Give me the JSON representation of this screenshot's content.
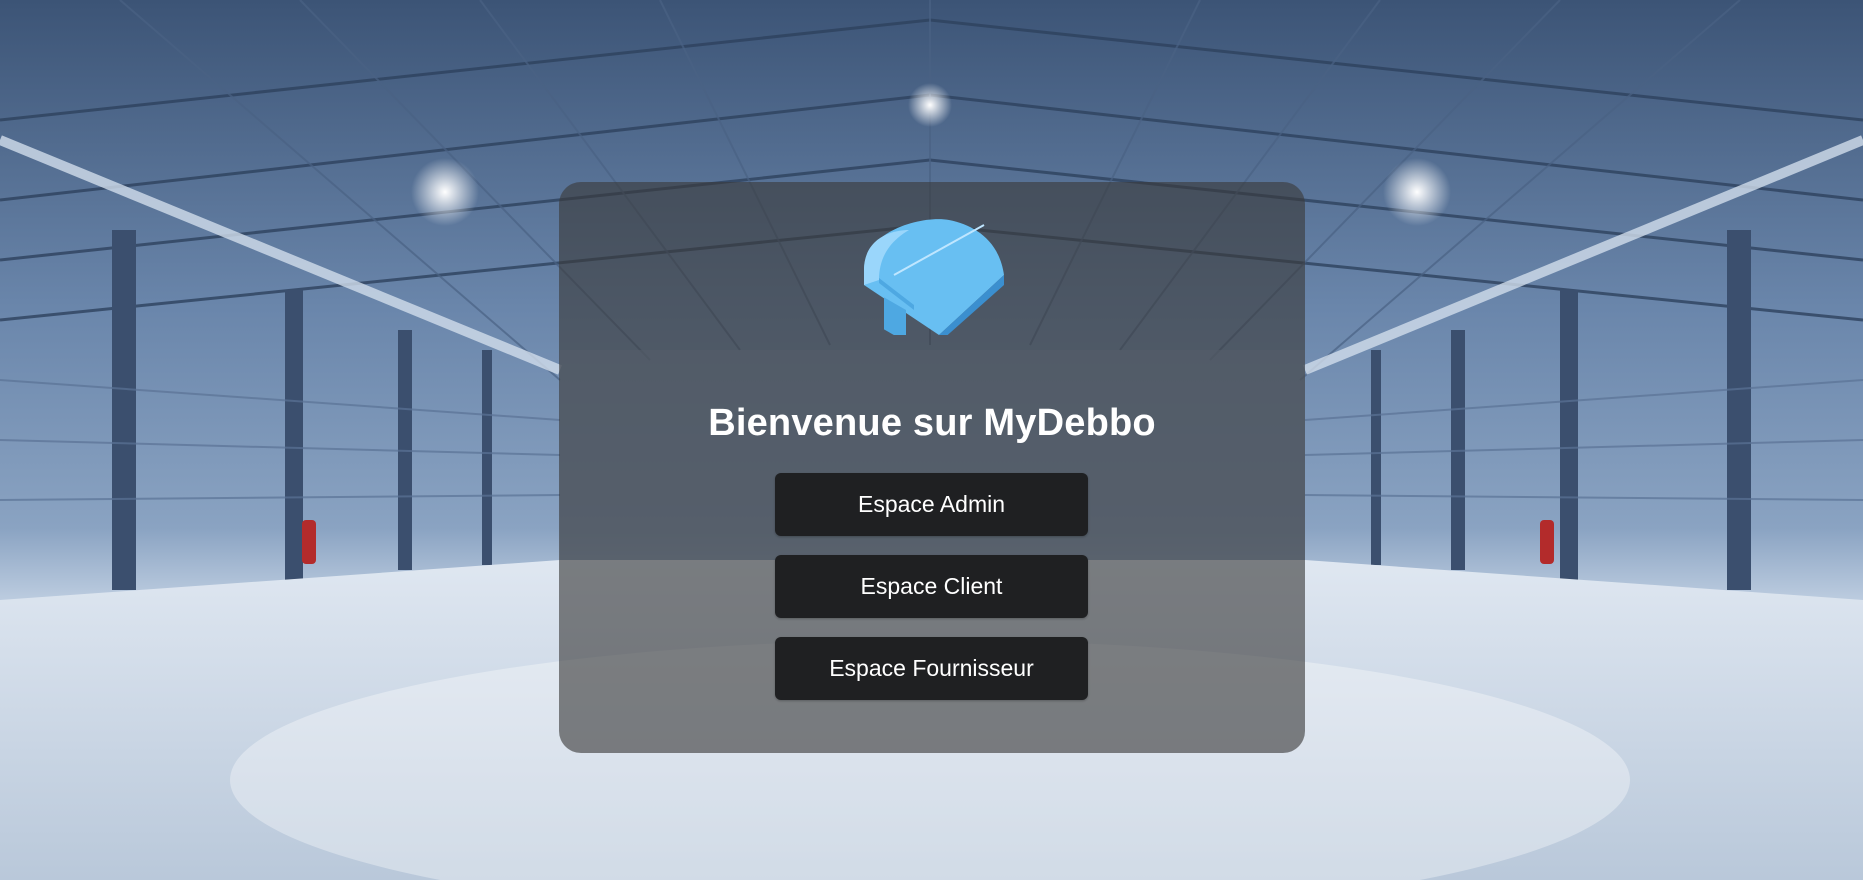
{
  "page": {
    "heading": "Bienvenue sur MyDebbo",
    "logo_icon": "hangar-icon",
    "background_image": "warehouse-interior"
  },
  "buttons": {
    "admin_label": "Espace Admin",
    "client_label": "Espace Client",
    "supplier_label": "Espace Fournisseur"
  },
  "colors": {
    "panel_overlay": "#3a3a3a",
    "button_bg": "#1f2022",
    "button_text": "#ffffff",
    "logo_blue": "#6cc0f3"
  }
}
